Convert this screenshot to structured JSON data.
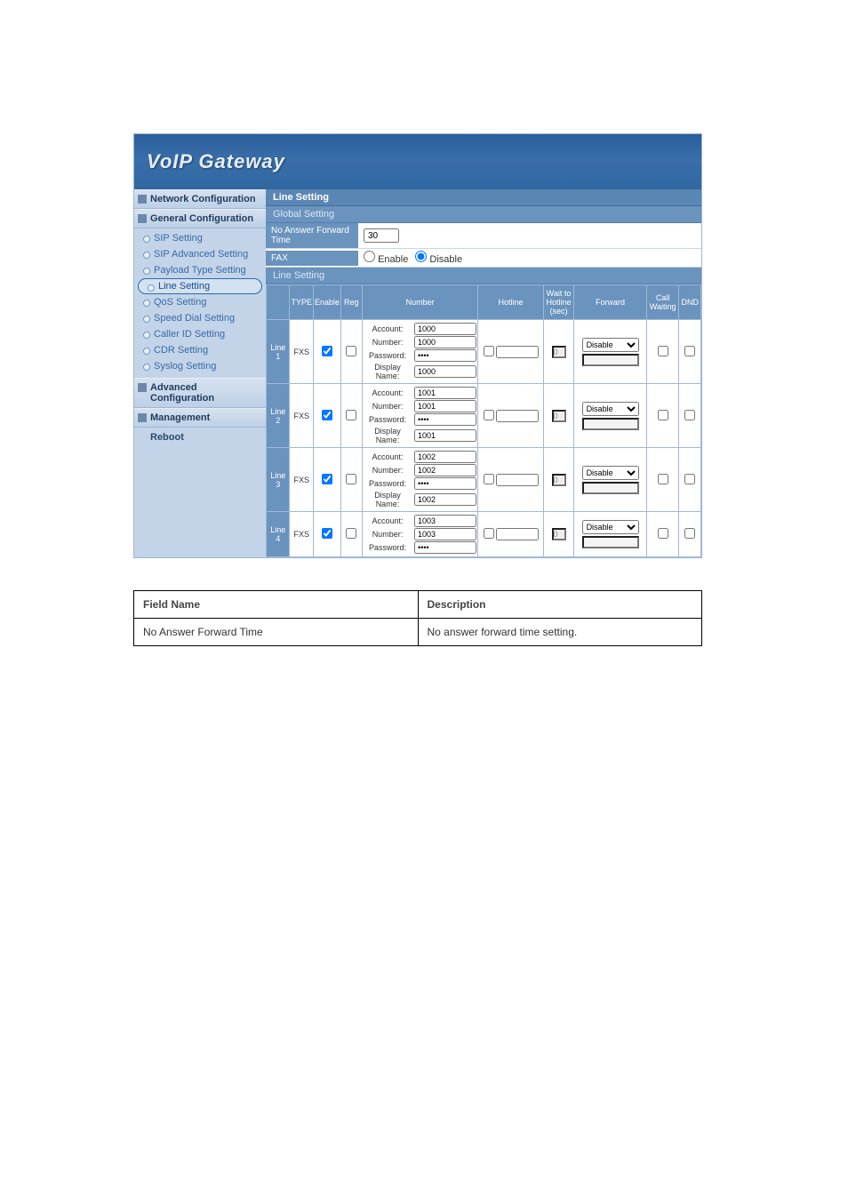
{
  "banner": {
    "title": "VoIP  Gateway"
  },
  "sidebar": {
    "sections": [
      {
        "label": "Network Configuration",
        "items": []
      },
      {
        "label": "General Configuration",
        "items": [
          {
            "label": "SIP Setting",
            "active": false
          },
          {
            "label": "SIP Advanced Setting",
            "active": false
          },
          {
            "label": "Payload Type Setting",
            "active": false
          },
          {
            "label": "Line Setting",
            "active": true
          },
          {
            "label": "QoS Setting",
            "active": false
          },
          {
            "label": "Speed Dial Setting",
            "active": false
          },
          {
            "label": "Caller ID Setting",
            "active": false
          },
          {
            "label": "CDR Setting",
            "active": false
          },
          {
            "label": "Syslog Setting",
            "active": false
          }
        ]
      },
      {
        "label": "Advanced Configuration",
        "items": []
      },
      {
        "label": "Management",
        "items": [],
        "plain_items": [
          "Reboot"
        ]
      }
    ]
  },
  "content": {
    "title": "Line Setting",
    "global_title": "Global Setting",
    "noans_label": "No Answer Forward Time",
    "noans_value": "30",
    "fax_label": "FAX",
    "fax_enable": "Enable",
    "fax_disable": "Disable",
    "fax_selected": "disable",
    "line_setting_sub": "Line Setting",
    "columns": {
      "line": "Line",
      "type": "TYPE",
      "enable": "Enable",
      "reg": "Reg",
      "number": "Number",
      "hotline": "Hotline",
      "wait": "Wait to Hotline (sec)",
      "forward": "Forward",
      "callwaiting": "Call Waiting",
      "dnd": "DND"
    },
    "labels": {
      "account": "Account:",
      "number": "Number:",
      "password": "Password:",
      "display": "Display Name:"
    },
    "lines": [
      {
        "name": "Line 1",
        "type": "FXS",
        "enable": true,
        "reg": false,
        "account": "1000",
        "number": "1000",
        "password": "••••",
        "display": "1000",
        "hotline": false,
        "wait": "0",
        "forward_sel": "Disable",
        "forward_val": "",
        "cw": false,
        "dnd": false
      },
      {
        "name": "Line 2",
        "type": "FXS",
        "enable": true,
        "reg": false,
        "account": "1001",
        "number": "1001",
        "password": "••••",
        "display": "1001",
        "hotline": false,
        "wait": "0",
        "forward_sel": "Disable",
        "forward_val": "",
        "cw": false,
        "dnd": false
      },
      {
        "name": "Line 3",
        "type": "FXS",
        "enable": true,
        "reg": false,
        "account": "1002",
        "number": "1002",
        "password": "••••",
        "display": "1002",
        "hotline": false,
        "wait": "0",
        "forward_sel": "Disable",
        "forward_val": "",
        "cw": false,
        "dnd": false
      },
      {
        "name": "Line 4",
        "type": "FXS",
        "enable": true,
        "reg": false,
        "account": "1003",
        "number": "1003",
        "password": "••••",
        "display": "",
        "hotline": false,
        "wait": "0",
        "forward_sel": "Disable",
        "forward_val": "",
        "cw": false,
        "dnd": false
      }
    ]
  },
  "def": {
    "h1": "Field Name",
    "h2": "Description",
    "r1a": "No Answer Forward Time",
    "r1b": "No answer forward time setting."
  }
}
